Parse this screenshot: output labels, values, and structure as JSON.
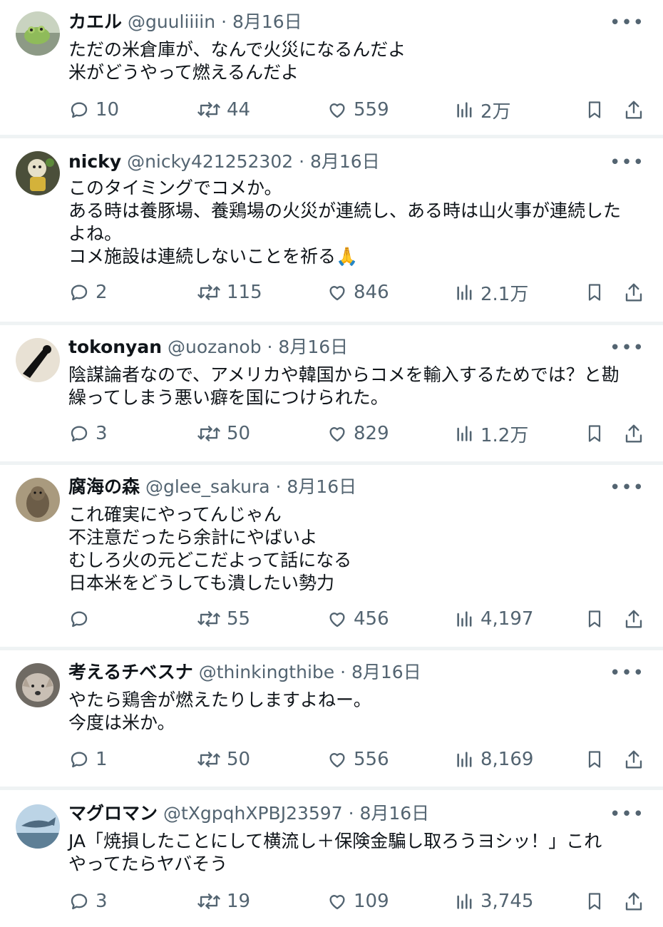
{
  "posts": [
    {
      "name": "カエル",
      "handle": "@guuliiiin",
      "date": "· 8月16日",
      "lines": [
        "ただの米倉庫が、なんで火災になるんだよ",
        "米がどうやって燃えるんだよ"
      ],
      "replies": "10",
      "reposts": "44",
      "likes": "559",
      "views": "2万",
      "avatar_color": "#7ea35a"
    },
    {
      "name": "nicky",
      "handle": "@nicky421252302",
      "date": "· 8月16日",
      "lines": [
        "このタイミングでコメか。",
        "ある時は養豚場、養鶏場の火災が連続し、ある時は山火事が連続した",
        "よね。",
        "コメ施設は連続しないことを祈る🙏"
      ],
      "replies": "2",
      "reposts": "115",
      "likes": "846",
      "views": "2.1万",
      "avatar_color": "#6f7f58"
    },
    {
      "name": "tokonyan",
      "handle": "@uozanob",
      "date": "· 8月16日",
      "lines": [
        "陰謀論者なので、アメリカや韓国からコメを輸入するためでは？と勘",
        "繰ってしまう悪い癖を国につけられた。"
      ],
      "replies": "3",
      "reposts": "50",
      "likes": "829",
      "views": "1.2万",
      "avatar_color": "#d9cfc0"
    },
    {
      "name": "腐海の森",
      "handle": "@glee_sakura",
      "date": "· 8月16日",
      "lines": [
        "これ確実にやってんじゃん",
        "不注意だったら余計にやばいよ",
        "むしろ火の元どこだよって話になる",
        "日本米をどうしても潰したい勢力"
      ],
      "replies": "",
      "reposts": "55",
      "likes": "456",
      "views": "4,197",
      "avatar_color": "#8a7a62"
    },
    {
      "name": "考えるチベスナ",
      "handle": "@thinkingthibe",
      "date": "· 8月16日",
      "lines": [
        "やたら鶏舎が燃えたりしますよねー。",
        "今度は米か。"
      ],
      "replies": "1",
      "reposts": "50",
      "likes": "556",
      "views": "8,169",
      "avatar_color": "#9a8f85"
    },
    {
      "name": "マグロマン",
      "handle": "@tXgpqhXPBJ23597",
      "date": "· 8月16日",
      "lines": [
        "JA「焼損したことにして横流し＋保険金騙し取ろうヨシッ！」これ",
        "やってたらヤバそう"
      ],
      "replies": "3",
      "reposts": "19",
      "likes": "109",
      "views": "3,745",
      "avatar_color": "#6a8fb0"
    }
  ],
  "icons": {
    "more": "more-icon",
    "reply": "reply-icon",
    "repost": "repost-icon",
    "like": "like-icon",
    "views": "views-icon",
    "bookmark": "bookmark-icon",
    "share": "share-icon"
  },
  "colors": {
    "text": "#0f1419",
    "muted": "#536471",
    "divider": "#eff3f4"
  }
}
